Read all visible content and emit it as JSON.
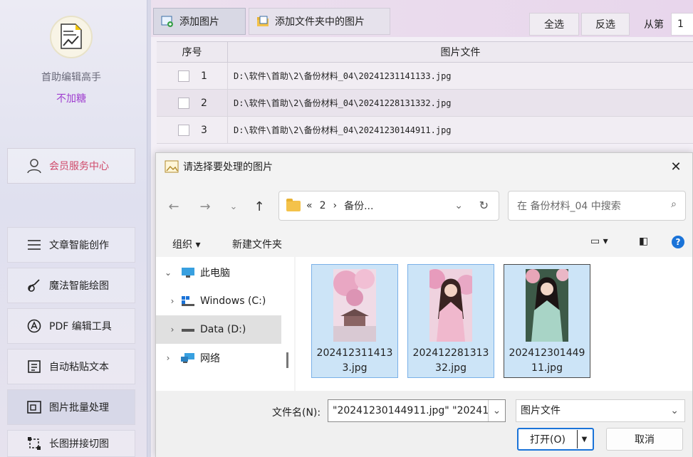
{
  "sidebar": {
    "app_name": "首助编辑高手",
    "slogan": "不加糖",
    "member_center": "会员服务中心",
    "items": [
      {
        "label": "文章智能创作",
        "icon": "list-icon"
      },
      {
        "label": "魔法智能绘图",
        "icon": "brush-icon"
      },
      {
        "label": "PDF 编辑工具",
        "icon": "pdf-a-icon"
      },
      {
        "label": "自动粘贴文本",
        "icon": "paste-icon"
      },
      {
        "label": "图片批量处理",
        "icon": "image-batch-icon"
      },
      {
        "label": "长图拼接切图",
        "icon": "crop-icon"
      }
    ]
  },
  "toolbar": {
    "add_image": "添加图片",
    "add_folder_images": "添加文件夹中的图片",
    "select_all": "全选",
    "invert_select": "反选",
    "from_label": "从第",
    "from_value": "1"
  },
  "table": {
    "headers": [
      "序号",
      "图片文件"
    ],
    "rows": [
      {
        "seq": "1",
        "file": "D:\\软件\\首助\\2\\备份材料_04\\20241231141133.jpg"
      },
      {
        "seq": "2",
        "file": "D:\\软件\\首助\\2\\备份材料_04\\20241228131332.jpg"
      },
      {
        "seq": "3",
        "file": "D:\\软件\\首助\\2\\备份材料_04\\20241230144911.jpg"
      }
    ]
  },
  "dialog": {
    "title": "请选择要处理的图片",
    "breadcrumb": [
      "«",
      "2",
      "›",
      "备份..."
    ],
    "search_placeholder": "在 备份材料_04 中搜索",
    "organize": "组织 ▾",
    "new_folder": "新建文件夹",
    "tree": [
      {
        "arrow": "⌄",
        "label": "此电脑",
        "icon": "computer-icon"
      },
      {
        "arrow": "›",
        "label": "Windows (C:)",
        "icon": "windows-drive-icon"
      },
      {
        "arrow": "›",
        "label": "Data (D:)",
        "icon": "drive-icon"
      },
      {
        "arrow": "›",
        "label": "网络",
        "icon": "network-icon"
      }
    ],
    "files": [
      {
        "name1": "202412311413",
        "name2": "3.jpg"
      },
      {
        "name1": "202412281313",
        "name2": "32.jpg"
      },
      {
        "name1": "202412301449",
        "name2": "11.jpg"
      }
    ],
    "filename_label": "文件名(N):",
    "filename_value": "\"20241230144911.jpg\" \"20241",
    "filetype_value": "图片文件",
    "open_label": "打开(O)",
    "cancel_label": "取消"
  }
}
